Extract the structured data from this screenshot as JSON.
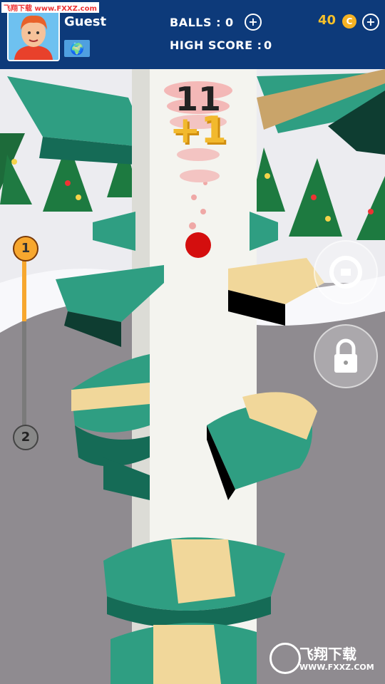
{
  "watermark_top": "飞翔下载 www.FXXZ.com",
  "header": {
    "player_name": "Guest",
    "balls_text": "BALLS : 0",
    "high_score_label": "HIGH SCORE :",
    "high_score_value": "0",
    "coins": "40",
    "coin_symbol": "C",
    "add_balls_label": "+",
    "add_coins_label": "+"
  },
  "game": {
    "score": "11",
    "bonus": "+1",
    "current_level": "1",
    "next_level": "2",
    "level_progress": 0.37
  },
  "colors": {
    "header_bg": "#0d3a7a",
    "platform_green": "#2f9e82",
    "platform_dark": "#156b56",
    "platform_cream": "#f1d79a",
    "ball": "#d40e0e",
    "column": "#f4f4ef",
    "coin_text": "#f5c02a",
    "level_orange": "#f7a72e"
  },
  "icons": [
    "avatar-icon",
    "globe-icon",
    "add-balls-icon",
    "coin-icon",
    "add-coins-icon",
    "settings-icon",
    "lock-icon"
  ],
  "watermark_bottom": {
    "title": "飞翔下载",
    "url": "WWW.FXXZ.COM"
  }
}
